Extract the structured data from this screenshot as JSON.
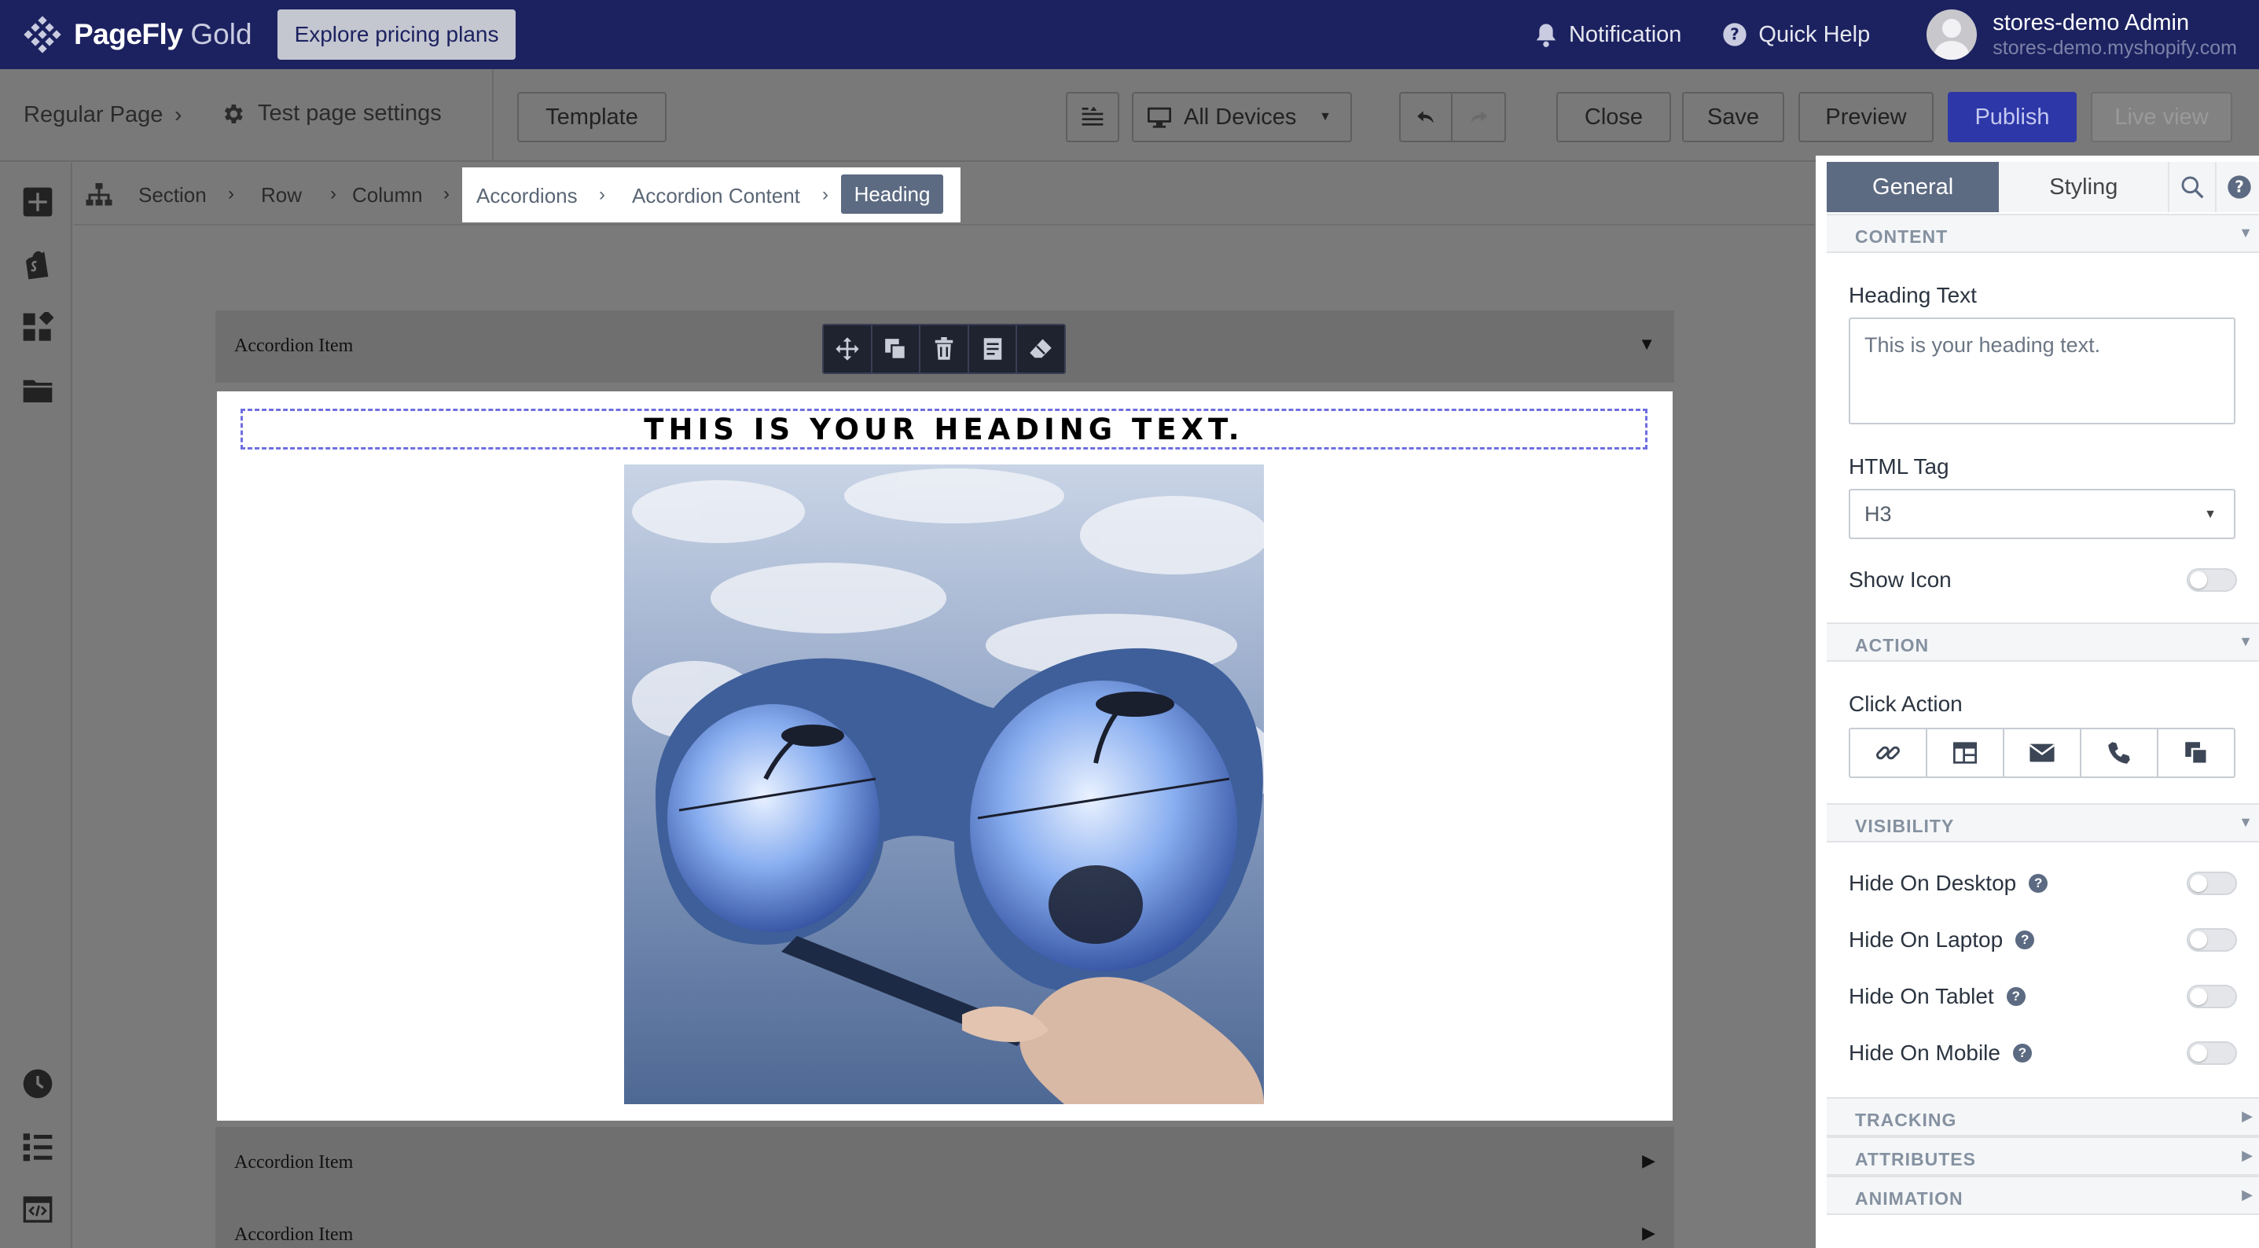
{
  "topbar": {
    "brand": "PageFly",
    "plan": "Gold",
    "pricing_button": "Explore pricing plans",
    "notification": "Notification",
    "quick_help": "Quick Help",
    "admin_name": "stores-demo Admin",
    "admin_store": "stores-demo.myshopify.com"
  },
  "toolbar": {
    "page_type": "Regular Page",
    "settings": "Test page settings",
    "template": "Template",
    "devices": "All Devices",
    "close": "Close",
    "save": "Save",
    "preview": "Preview",
    "publish": "Publish",
    "live_view": "Live view"
  },
  "element_breadcrumb": [
    "Section",
    "Row",
    "Column",
    "Accordions",
    "Accordion Content",
    "Heading"
  ],
  "canvas": {
    "accordion_items": [
      "Accordion Item",
      "Accordion Item",
      "Accordion Item"
    ],
    "heading": "THIS IS YOUR HEADING TEXT."
  },
  "panel": {
    "tabs": {
      "general": "General",
      "styling": "Styling"
    },
    "content": {
      "section": "CONTENT",
      "heading_text_label": "Heading Text",
      "heading_text_value": "This is your heading text.",
      "html_tag_label": "HTML Tag",
      "html_tag_value": "H3",
      "show_icon_label": "Show Icon"
    },
    "action": {
      "section": "ACTION",
      "click_action_label": "Click Action"
    },
    "visibility": {
      "section": "VISIBILITY",
      "items": [
        "Hide On Desktop",
        "Hide On Laptop",
        "Hide On Tablet",
        "Hide On Mobile"
      ]
    },
    "collapsed_sections": [
      "TRACKING",
      "ATTRIBUTES",
      "ANIMATION"
    ]
  },
  "colors": {
    "topbar_bg": "#1c2260",
    "publish": "#2d37a8",
    "active_tab": "#5c6a82",
    "heading_outline": "#6f6fe0"
  }
}
